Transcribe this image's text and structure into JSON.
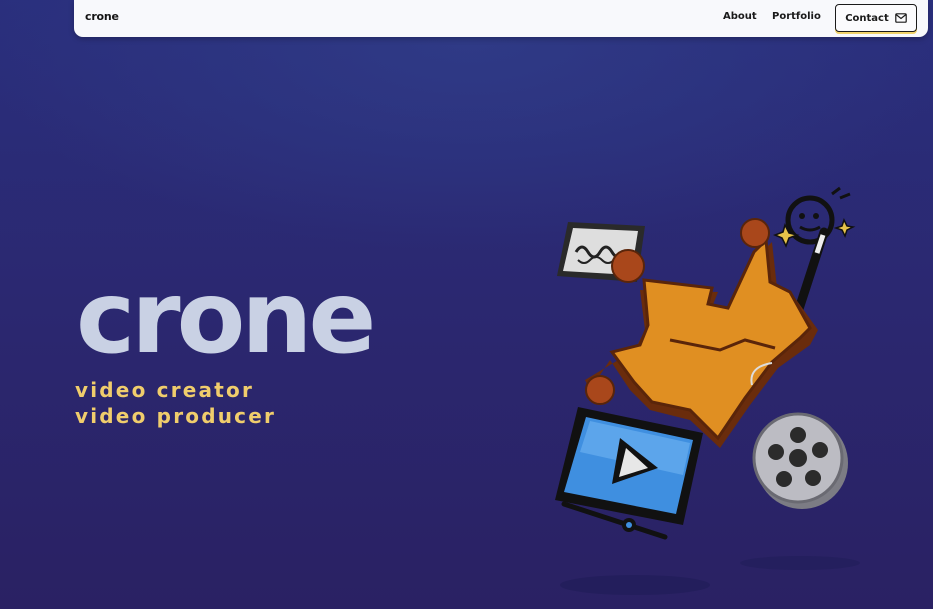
{
  "nav": {
    "brand": "crone",
    "links": [
      {
        "label": "About"
      },
      {
        "label": "Portfolio"
      }
    ],
    "contact": {
      "label": "Contact",
      "icon": "mail-icon"
    }
  },
  "hero": {
    "title": "crone",
    "taglines": [
      "video creator",
      "video producer"
    ]
  },
  "colors": {
    "background": "#2b2a73",
    "title": "#c9d1e4",
    "tagline": "#f0cd6c",
    "nav_bg": "#f8f9fc",
    "crown": "#e08f22",
    "screen": "#3f8fe0"
  },
  "illustration": {
    "icons": [
      "clapper-icon",
      "crown-icon",
      "magic-wand-icon",
      "monitor-play-icon",
      "film-reel-icon"
    ]
  }
}
